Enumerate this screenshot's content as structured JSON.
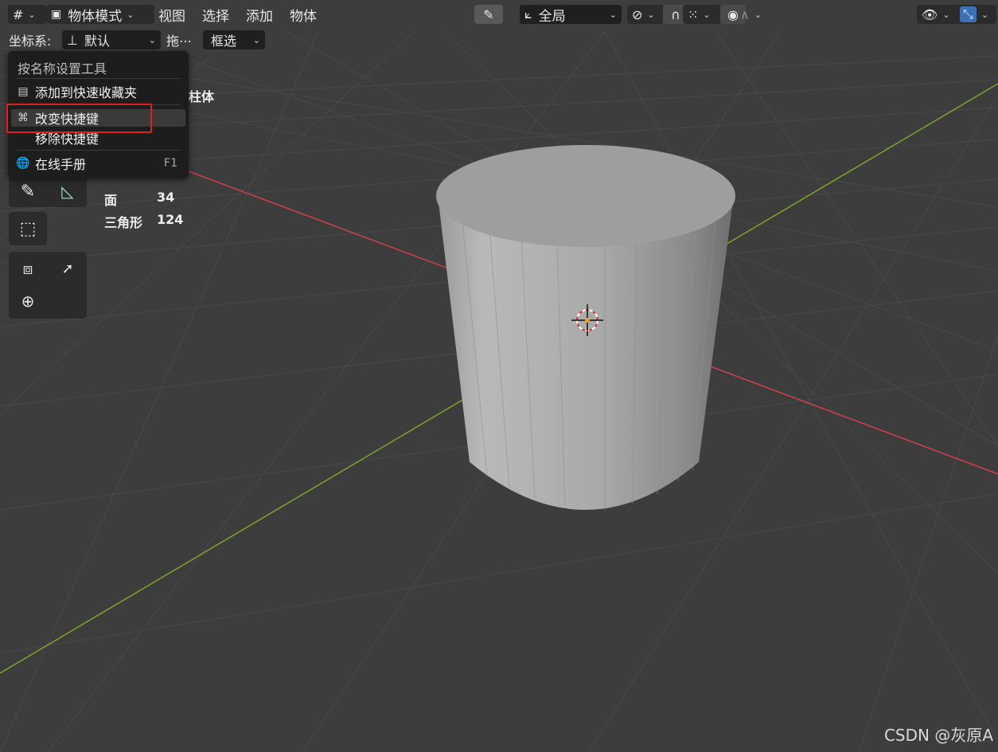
{
  "header": {
    "mode_label": "物体模式",
    "menus": [
      "视图",
      "选择",
      "添加",
      "物体"
    ],
    "transform_orientation": "全局"
  },
  "subbar": {
    "coord_label": "坐标系:",
    "coord_value": "默认",
    "drag_label": "拖⋯",
    "select_mode": "框选"
  },
  "context_menu": {
    "title": "按名称设置工具",
    "items": [
      {
        "label": "添加到快速收藏夹",
        "icon": "favorites-icon"
      },
      {
        "label": "改变快捷键",
        "icon": "command-key-icon",
        "highlighted": true
      },
      {
        "label": "移除快捷键",
        "icon": ""
      },
      {
        "label": "在线手册",
        "icon": "globe-icon",
        "shortcut": "F1"
      }
    ]
  },
  "overlay": {
    "object_name_partial": "柱体",
    "stats": [
      {
        "label": "面",
        "value": "34"
      },
      {
        "label": "三角形",
        "value": "124"
      }
    ]
  },
  "watermark": "CSDN @灰原A",
  "colors": {
    "background": "#3d3d3d",
    "x_axis": "#c8404a",
    "y_axis": "#7a9e2e",
    "highlight_box": "#e02020",
    "active_blue": "#3c6fb3"
  }
}
